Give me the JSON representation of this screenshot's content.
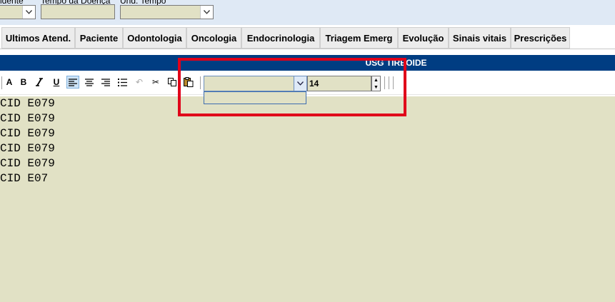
{
  "top_fields": {
    "label_accident": "Acidente",
    "label_disease_time": "Tempo da Doença",
    "label_time_unit": "Und. Tempo",
    "accident_value": "",
    "disease_time_value": "",
    "time_unit_value": ""
  },
  "tabs": [
    {
      "label": "Ultimos Atend."
    },
    {
      "label": "Paciente"
    },
    {
      "label": "Odontologia"
    },
    {
      "label": "Oncologia"
    },
    {
      "label": "Endocrinologia"
    },
    {
      "label": "Triagem Emerg"
    },
    {
      "label": "Evolução"
    },
    {
      "label": "Sinais vitais"
    },
    {
      "label": "Prescrições"
    }
  ],
  "section_title": "USG TIREOIDE",
  "toolbar": {
    "font_name": "",
    "font_size": "14",
    "icons": [
      "font-color-icon",
      "bold-icon",
      "italic-icon",
      "underline-icon",
      "align-left-icon",
      "align-center-icon",
      "align-right-icon",
      "bullet-list-icon",
      "undo-icon",
      "cut-icon",
      "copy-icon",
      "paste-icon"
    ]
  },
  "editor": {
    "lines": [
      "CID E079",
      "CID E079",
      "CID E079",
      "CID E079",
      "CID E079",
      "CID E07"
    ]
  },
  "colors": {
    "title_bar": "#003d82",
    "field_bg": "#e1e1c5",
    "highlight": "#e0001a"
  }
}
